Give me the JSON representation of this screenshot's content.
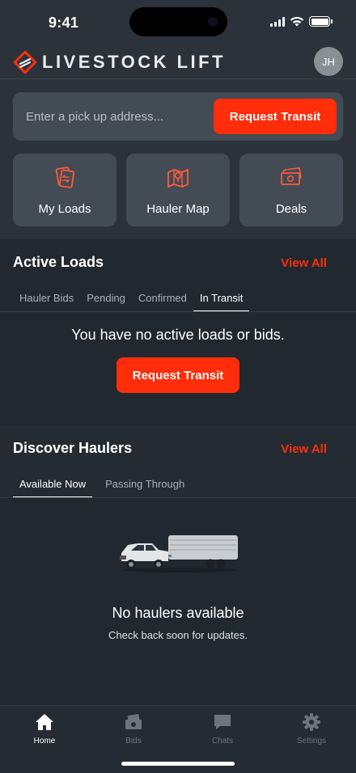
{
  "status_bar": {
    "time": "9:41"
  },
  "header": {
    "brand": "LIVESTOCK LIFT",
    "avatar_initials": "JH"
  },
  "search": {
    "placeholder": "Enter a pick up address...",
    "button_label": "Request Transit"
  },
  "quick_actions": [
    {
      "label": "My Loads",
      "icon": "loads-icon"
    },
    {
      "label": "Hauler Map",
      "icon": "map-icon"
    },
    {
      "label": "Deals",
      "icon": "deals-icon"
    }
  ],
  "active_loads": {
    "title": "Active Loads",
    "view_all": "View All",
    "tabs": [
      "Hauler Bids",
      "Pending",
      "Confirmed",
      "In Transit"
    ],
    "active_tab": "In Transit",
    "empty_message": "You have no active loads or bids.",
    "empty_button": "Request Transit"
  },
  "discover": {
    "title": "Discover Haulers",
    "view_all": "View All",
    "tabs": [
      "Available Now",
      "Passing Through"
    ],
    "active_tab": "Available Now",
    "empty_title": "No haulers available",
    "empty_subtitle": "Check back soon for updates."
  },
  "tab_bar": [
    {
      "label": "Home",
      "icon": "home-icon",
      "active": true
    },
    {
      "label": "Bids",
      "icon": "bids-icon",
      "active": false
    },
    {
      "label": "Chats",
      "icon": "chat-icon",
      "active": false
    },
    {
      "label": "Settings",
      "icon": "gear-icon",
      "active": false
    }
  ],
  "colors": {
    "accent": "#ff2d0a",
    "background": "#2b323a",
    "card": "#434b54"
  }
}
